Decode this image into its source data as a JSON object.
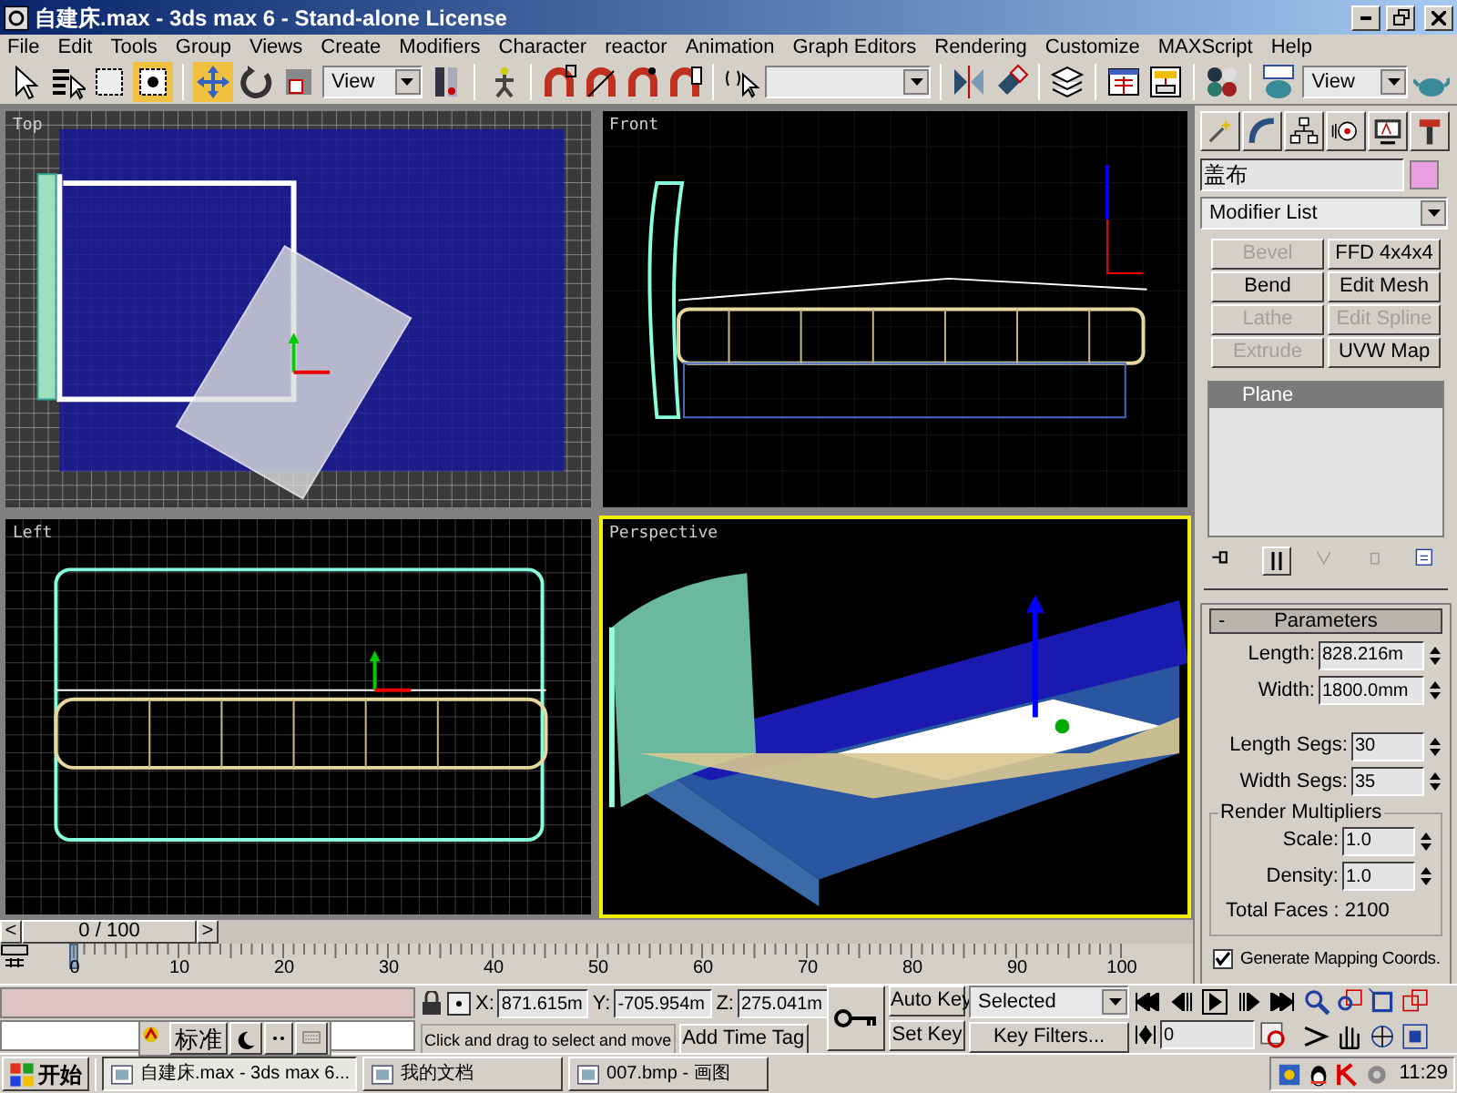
{
  "window": {
    "title": "自建床.max - 3ds max 6 - Stand-alone License"
  },
  "menu": [
    "File",
    "Edit",
    "Tools",
    "Group",
    "Views",
    "Create",
    "Modifiers",
    "Character",
    "reactor",
    "Animation",
    "Graph Editors",
    "Rendering",
    "Customize",
    "MAXScript",
    "Help"
  ],
  "toolbar": {
    "coordinate_system": "View",
    "render_type": "View"
  },
  "viewports": [
    {
      "label": "Top",
      "selected": false,
      "kind": "top"
    },
    {
      "label": "Front",
      "selected": false,
      "kind": "front"
    },
    {
      "label": "Left",
      "selected": false,
      "kind": "left"
    },
    {
      "label": "Perspective",
      "selected": true,
      "kind": "perspective"
    }
  ],
  "command_panel": {
    "object_name": "盖布",
    "modifier_list": "Modifier List",
    "modifier_buttons": [
      {
        "label": "Bevel",
        "disabled": true
      },
      {
        "label": "FFD 4x4x4",
        "disabled": false
      },
      {
        "label": "Bend",
        "disabled": false
      },
      {
        "label": "Edit Mesh",
        "disabled": false
      },
      {
        "label": "Lathe",
        "disabled": true
      },
      {
        "label": "Edit Spline",
        "disabled": true
      },
      {
        "label": "Extrude",
        "disabled": true
      },
      {
        "label": "UVW Map",
        "disabled": false
      }
    ],
    "stack": [
      {
        "label": "Plane",
        "selected": true
      }
    ],
    "parameters": {
      "toggle": "-",
      "title": "Parameters",
      "fields": [
        {
          "label": "Length:",
          "value": "828.216m"
        },
        {
          "label": "Width:",
          "value": "1800.0mm"
        }
      ],
      "segs": [
        {
          "label": "Length Segs:",
          "value": "30"
        },
        {
          "label": "Width Segs:",
          "value": "35"
        }
      ],
      "group_title": "Render Multipliers",
      "multipliers": [
        {
          "label": "Scale:",
          "value": "1.0"
        },
        {
          "label": "Density:",
          "value": "1.0"
        }
      ],
      "total_faces": "Total Faces : 2100",
      "mapping": {
        "label": "Generate Mapping Coords.",
        "checked": true
      }
    }
  },
  "timeline": {
    "prev": "<",
    "position": "0 / 100",
    "next": ">",
    "ticks": [
      "0",
      "10",
      "20",
      "30",
      "40",
      "50",
      "60",
      "70",
      "80",
      "90",
      "100"
    ]
  },
  "status": {
    "x_label": "X:",
    "x": "871.615m",
    "y_label": "Y:",
    "y": "-705.954m",
    "z_label": "Z:",
    "z": "275.041m",
    "prompt": "Click and drag to select and move",
    "time_tag": "Add Time Tag",
    "auto_key": "Auto Key",
    "set_key": "Set Key",
    "key_mode": "Selected",
    "key_filters": "Key Filters...",
    "frame": "0"
  },
  "ime": {
    "mode": "标准"
  },
  "taskbar": {
    "start": "开始",
    "tasks": [
      {
        "label": "自建床.max - 3ds max 6...",
        "selected": true
      },
      {
        "label": "我的文档",
        "selected": false
      },
      {
        "label": "007.bmp - 画图",
        "selected": false
      }
    ],
    "clock": "11:29"
  }
}
